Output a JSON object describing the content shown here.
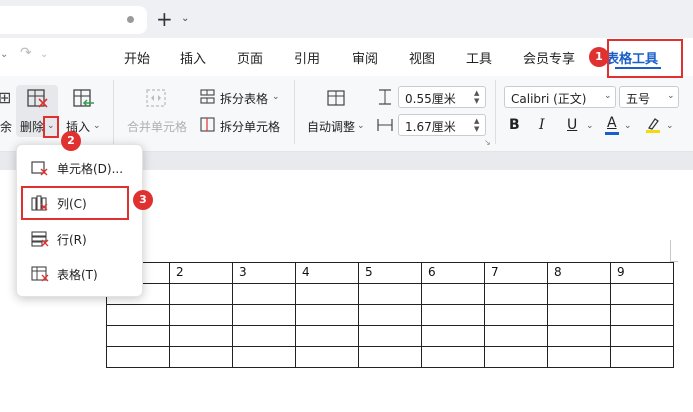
{
  "tabbar": {
    "new_tab_icon": "plus-icon"
  },
  "menubar": {
    "items": [
      "开始",
      "插入",
      "页面",
      "引用",
      "审阅",
      "视图",
      "工具",
      "会员专享"
    ],
    "active": "表格工具"
  },
  "ribbon": {
    "partial_left_label": "余",
    "delete_label": "删除",
    "insert_label": "插入",
    "merge_cells_label": "合并单元格",
    "split_table_label": "拆分表格",
    "split_cells_label": "拆分单元格",
    "autofit_label": "自动调整",
    "row_height_value": "0.55厘米",
    "col_width_value": "1.67厘米",
    "font_name": "Calibri (正文)",
    "font_size": "五号",
    "bold": "B",
    "italic": "I",
    "underline": "U",
    "font_color": "A",
    "highlight_color": "#f5d90a",
    "font_color_bar": "#1a5fc7"
  },
  "dropdown": {
    "items": [
      "单元格(D)...",
      "列(C)",
      "行(R)",
      "表格(T)"
    ]
  },
  "table": {
    "header": [
      "",
      "2",
      "3",
      "4",
      "5",
      "6",
      "7",
      "8",
      "9"
    ],
    "empty_rows": 4
  },
  "annotations": [
    "1",
    "2",
    "3"
  ],
  "colors": {
    "accent": "#1a5fc7",
    "annotation": "#e03131"
  }
}
